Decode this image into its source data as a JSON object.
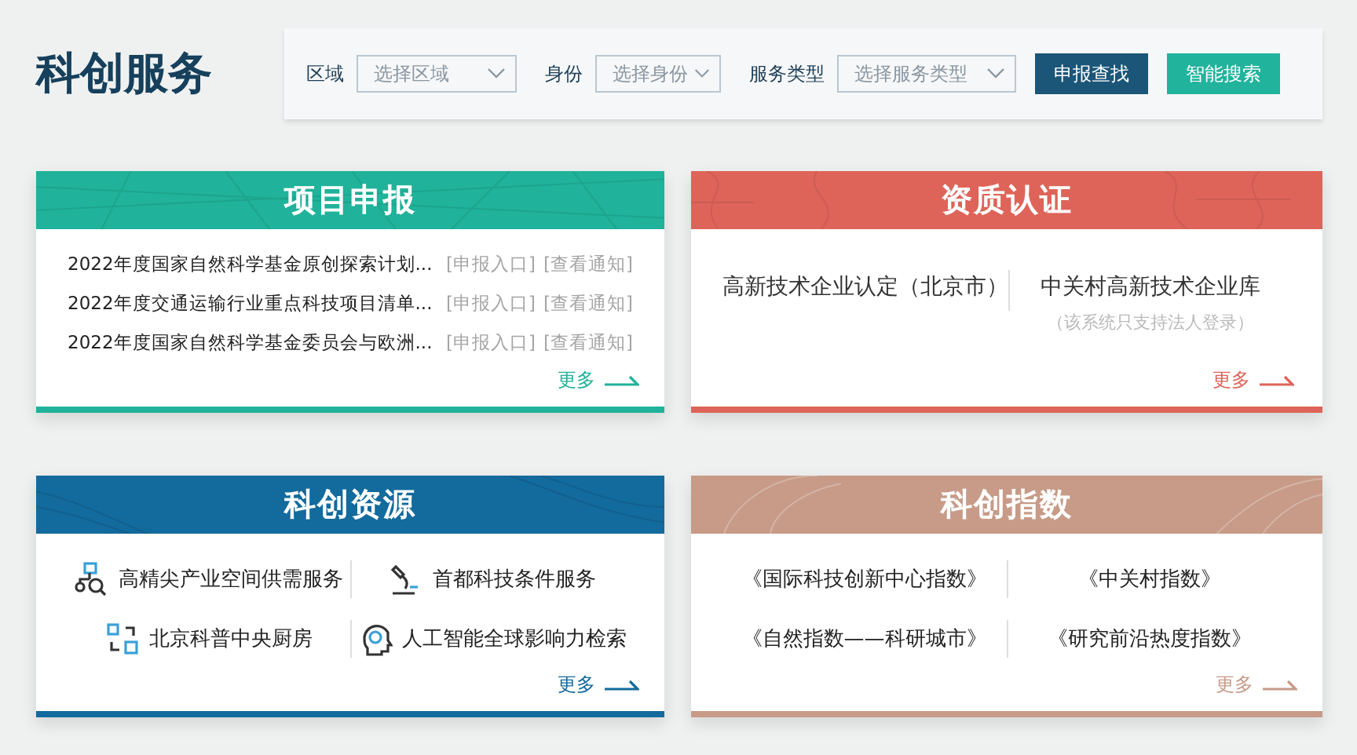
{
  "page_title": "科创服务",
  "filters": [
    {
      "label": "区域",
      "placeholder": "选择区域"
    },
    {
      "label": "身份",
      "placeholder": "选择身份"
    },
    {
      "label": "服务类型",
      "placeholder": "选择服务类型"
    }
  ],
  "buttons": [
    {
      "label": "申报查找",
      "color": "#1b5577"
    },
    {
      "label": "智能搜索",
      "color": "#22b39c"
    }
  ],
  "cards": [
    {
      "kind": "projects",
      "title": "项目申报",
      "color": "#20b29a",
      "more": "更多",
      "rows": [
        {
          "title": "2022年度国家自然科学基金原创探索计划...",
          "links": [
            "[申报入口]",
            "[查看通知]"
          ]
        },
        {
          "title": "2022年度交通运输行业重点科技项目清单...",
          "links": [
            "[申报入口]",
            "[查看通知]"
          ]
        },
        {
          "title": "2022年度国家自然科学基金委员会与欧洲...",
          "links": [
            "[申报入口]",
            "[查看通知]"
          ]
        }
      ]
    },
    {
      "kind": "certification",
      "title": "资质认证",
      "color": "#de6459",
      "more": "更多",
      "rows": [
        {
          "items": [
            {
              "label": "高新技术企业认定（北京市）"
            },
            {
              "label": "中关村高新技术企业库",
              "note": "（该系统只支持法人登录）"
            }
          ]
        }
      ]
    },
    {
      "kind": "resources",
      "title": "科创资源",
      "color": "#136a9c",
      "more": "更多",
      "rows": [
        {
          "items": [
            {
              "label": "高精尖产业空间供需服务"
            },
            {
              "label": "首都科技条件服务"
            }
          ]
        },
        {
          "items": [
            {
              "label": "北京科普中央厨房"
            },
            {
              "label": "人工智能全球影响力检索"
            }
          ]
        }
      ]
    },
    {
      "kind": "indices",
      "title": "科创指数",
      "color": "#c79b88",
      "more": "更多",
      "rows": [
        {
          "items": [
            {
              "label": "《国际科技创新中心指数》"
            },
            {
              "label": "《中关村指数》"
            }
          ]
        },
        {
          "items": [
            {
              "label": "《自然指数——科研城市》"
            },
            {
              "label": "《研究前沿热度指数》"
            }
          ]
        }
      ]
    }
  ]
}
